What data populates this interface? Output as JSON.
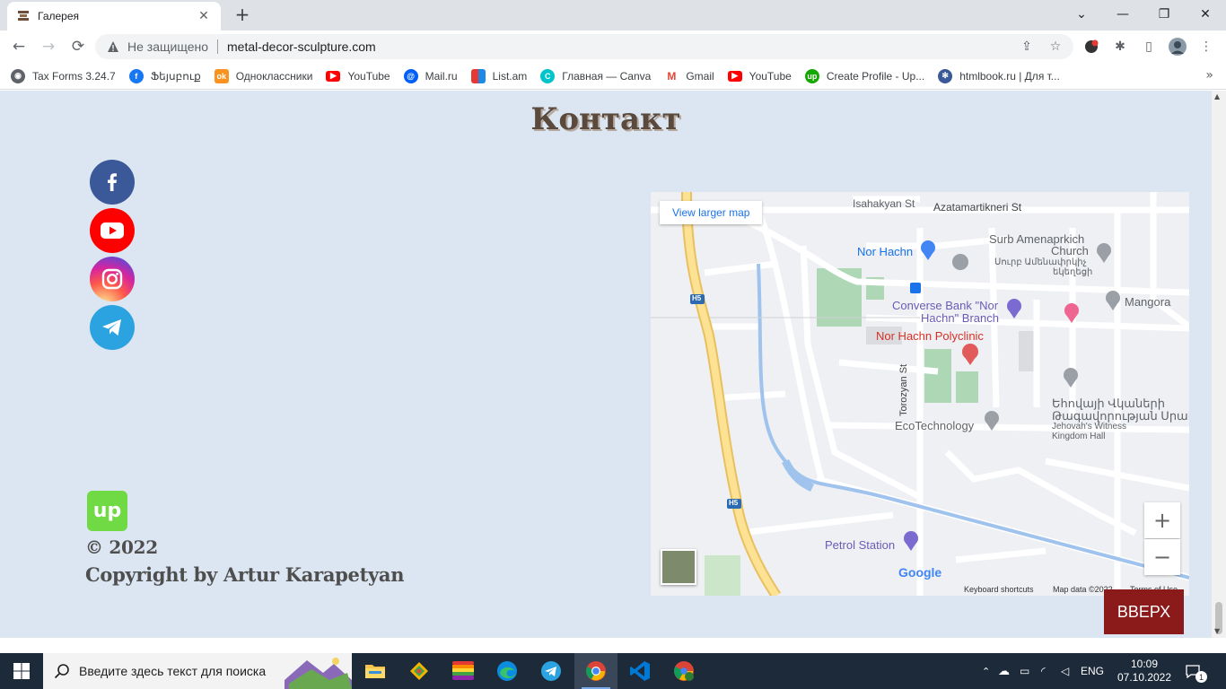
{
  "browser": {
    "tab_title": "Галерея",
    "insecure_label": "Не защищено",
    "url": "metal-decor-sculpture.com"
  },
  "bookmarks": [
    {
      "label": "Tax Forms 3.24.7",
      "icon": "globe-icon",
      "color": "#5f6368"
    },
    {
      "label": "Ֆեյսբուք",
      "icon": "facebook-icon",
      "color": "#1877f2"
    },
    {
      "label": "Одноклассники",
      "icon": "odnoklassniki-icon",
      "color": "#f7931e"
    },
    {
      "label": "YouTube",
      "icon": "youtube-icon",
      "color": "#ff0000"
    },
    {
      "label": "Mail.ru",
      "icon": "mailru-icon",
      "color": "#005ff9"
    },
    {
      "label": "List.am",
      "icon": "listam-icon",
      "color": "#e53935"
    },
    {
      "label": "Главная — Canva",
      "icon": "canva-icon",
      "color": "#00c4cc"
    },
    {
      "label": "Gmail",
      "icon": "gmail-icon",
      "color": "#ea4335"
    },
    {
      "label": "YouTube",
      "icon": "youtube-icon",
      "color": "#ff0000"
    },
    {
      "label": "Create Profile - Up...",
      "icon": "upwork-icon",
      "color": "#14a800"
    },
    {
      "label": "htmlbook.ru | Для т...",
      "icon": "htmlbook-icon",
      "color": "#3b5998"
    }
  ],
  "page": {
    "heading": "Контакт",
    "social_links": [
      {
        "name": "facebook",
        "color": "#3b5998"
      },
      {
        "name": "youtube",
        "color": "#ff0000"
      },
      {
        "name": "instagram",
        "color": "#c13584"
      },
      {
        "name": "telegram",
        "color": "#2aa3e0"
      }
    ],
    "copyright_year": "© 2022",
    "copyright_text": "Copyright by Artur Karapetyan",
    "back_to_top": "ВВЕРХ",
    "map": {
      "view_larger": "View larger map",
      "labels": {
        "isahakyan": "Isahakyan St",
        "azatamartikneri": "Azatamartikneri St",
        "nor_hachn": "Nor Hachn",
        "church_en_1": "Surb Amenaprkich",
        "church_en_2": "Church",
        "church_hy_1": "Սուրբ Ամենափրկիչ",
        "church_hy_2": "եկեղեցի",
        "mangora": "Mangora",
        "bank_1": "Converse Bank \"Nor",
        "bank_2": "Hachn\" Branch",
        "polyclinic": "Nor Hachn Polyclinic",
        "torozyan": "Torozyan St",
        "hall_hy_1": "Եհովայի Վկաների",
        "hall_hy_2": "Թագավորության Սրահ",
        "hall_en_1": "Jehovah's Witness",
        "hall_en_2": "Kingdom Hall",
        "ecotech": "EcoTechnology",
        "petrol": "Petrol Station",
        "h5": "H5",
        "google": "Google",
        "keyboard": "Keyboard shortcuts",
        "mapdata": "Map data ©2022",
        "terms": "Terms of Use"
      }
    }
  },
  "taskbar": {
    "search_placeholder": "Введите здесь текст для поиска",
    "language": "ENG",
    "time": "10:09",
    "date": "07.10.2022",
    "notification_count": "1"
  }
}
